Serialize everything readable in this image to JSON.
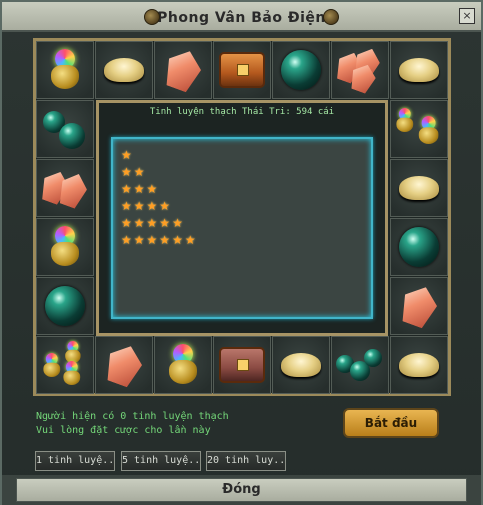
{
  "window": {
    "title": "Phong Vân Bảo Điện",
    "close_glyph": "×"
  },
  "board": {
    "top_row": [
      "pot-icon",
      "gold-ingot-icon",
      "crystal-icon",
      "treasure-chest-icon",
      "orb-icon",
      "crystal-cluster-icon",
      "gold-ingot-icon"
    ],
    "left_col": [
      "orb-pair-icon",
      "crystal-icon",
      "pot-icon",
      "orb-icon"
    ],
    "right_col": [
      "pot-pair-icon",
      "gold-ingot-icon",
      "orb-icon",
      "crystal-icon"
    ],
    "bottom_row": [
      "pot-trio-icon",
      "crystal-icon",
      "pot-icon",
      "treasure-chest-icon",
      "gold-ingot-icon",
      "orb-trio-icon",
      "gold-ingot-icon"
    ]
  },
  "center": {
    "header": "Tinh luyện thạch Thái Tri: 594 cái",
    "star_rows": [
      1,
      2,
      3,
      4,
      5,
      6
    ],
    "star_glyph": "★"
  },
  "info": {
    "line1": "Người hiện có 0 tinh luyện thạch",
    "line2": "Vui lòng đặt cược cho lần này"
  },
  "buttons": {
    "start": "Bắt đầu",
    "bet1": "1 tinh luyệ..",
    "bet5": "5 tinh luyệ..",
    "bet20": "20 tinh luy..",
    "close": "Đóng"
  },
  "colors": {
    "accent_gold": "#e9b551",
    "text_green": "#74d779",
    "star_orange": "#ff9e24"
  }
}
